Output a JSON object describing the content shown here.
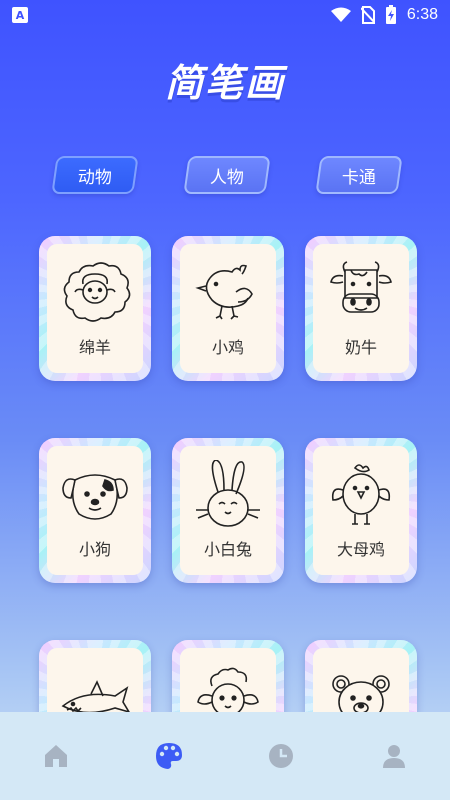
{
  "status_bar": {
    "time": "6:38"
  },
  "title": "简笔画",
  "tabs": [
    {
      "label": "动物",
      "active": true
    },
    {
      "label": "人物",
      "active": false
    },
    {
      "label": "卡通",
      "active": false
    }
  ],
  "cards": [
    {
      "label": "绵羊",
      "icon": "sheep-drawing"
    },
    {
      "label": "小鸡",
      "icon": "chick-drawing"
    },
    {
      "label": "奶牛",
      "icon": "cow-drawing"
    },
    {
      "label": "小狗",
      "icon": "puppy-drawing"
    },
    {
      "label": "小白兔",
      "icon": "rabbit-drawing"
    },
    {
      "label": "大母鸡",
      "icon": "hen-drawing"
    },
    {
      "label": "",
      "icon": "shark-drawing"
    },
    {
      "label": "",
      "icon": "lamb-drawing"
    },
    {
      "label": "",
      "icon": "bear-drawing"
    }
  ],
  "bottom_nav": [
    {
      "icon": "home-icon",
      "active": false
    },
    {
      "icon": "palette-icon",
      "active": true
    },
    {
      "icon": "clock-icon",
      "active": false
    },
    {
      "icon": "profile-icon",
      "active": false
    }
  ],
  "colors": {
    "active_nav": "#3d5cf5",
    "inactive_nav": "#a7b3c2",
    "tab_active": "#2f5cf3"
  }
}
